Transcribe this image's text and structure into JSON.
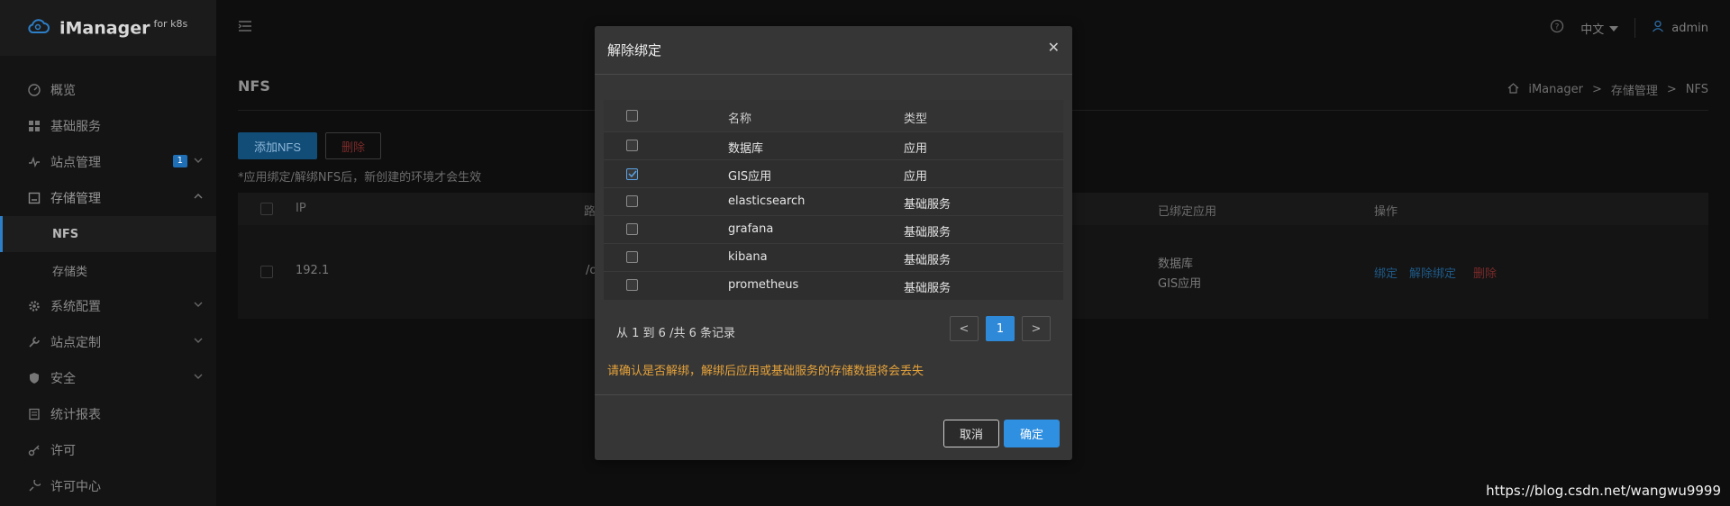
{
  "app": {
    "title": "iManager",
    "subtitle": "for k8s"
  },
  "sidebar": {
    "items": [
      {
        "label": "概览",
        "icon": "dashboard-icon"
      },
      {
        "label": "基础服务",
        "icon": "grid-icon"
      },
      {
        "label": "站点管理",
        "icon": "pulse-icon",
        "badge": "1"
      },
      {
        "label": "存储管理",
        "icon": "storage-icon"
      },
      {
        "label": "系统配置",
        "icon": "gear-icon"
      },
      {
        "label": "站点定制",
        "icon": "wrench-icon"
      },
      {
        "label": "安全",
        "icon": "shield-icon"
      },
      {
        "label": "统计报表",
        "icon": "report-icon"
      },
      {
        "label": "许可",
        "icon": "key-icon"
      },
      {
        "label": "许可中心",
        "icon": "license-center-icon"
      }
    ],
    "storage_sub": [
      "NFS",
      "存储类"
    ]
  },
  "header": {
    "language": "中文",
    "user": "admin"
  },
  "page": {
    "title": "NFS",
    "breadcrumb": [
      "iManager",
      "存储管理",
      "NFS"
    ],
    "add_button": "添加NFS",
    "delete_button": "删除",
    "note": "*应用绑定/解绑NFS后，新创建的环境才会生效",
    "table_headers": {
      "ip": "IP",
      "path": "路",
      "bound": "已绑定应用",
      "ops": "操作"
    },
    "row": {
      "ip": "192.1",
      "path": "/o",
      "bound": [
        "数据库",
        "GIS应用"
      ],
      "ops": [
        "绑定",
        "解除绑定",
        "删除"
      ]
    }
  },
  "modal": {
    "title": "解除绑定",
    "headers": {
      "name": "名称",
      "type": "类型"
    },
    "rows": [
      {
        "name": "数据库",
        "type": "应用",
        "checked": false
      },
      {
        "name": "GIS应用",
        "type": "应用",
        "checked": true
      },
      {
        "name": "elasticsearch",
        "type": "基础服务",
        "checked": false
      },
      {
        "name": "grafana",
        "type": "基础服务",
        "checked": false
      },
      {
        "name": "kibana",
        "type": "基础服务",
        "checked": false
      },
      {
        "name": "prometheus",
        "type": "基础服务",
        "checked": false
      }
    ],
    "count_text": "从 1 到 6 /共 6 条记录",
    "pager": {
      "prev": "<",
      "current": "1",
      "next": ">"
    },
    "warning": "请确认是否解绑，解绑后应用或基础服务的存储数据将会丢失",
    "cancel": "取消",
    "confirm": "确定"
  },
  "watermark": "https://blog.csdn.net/wangwu9999",
  "colors": {
    "accent": "#2f8fe0",
    "warning": "#e5a23a",
    "modal_bg": "#363636"
  }
}
